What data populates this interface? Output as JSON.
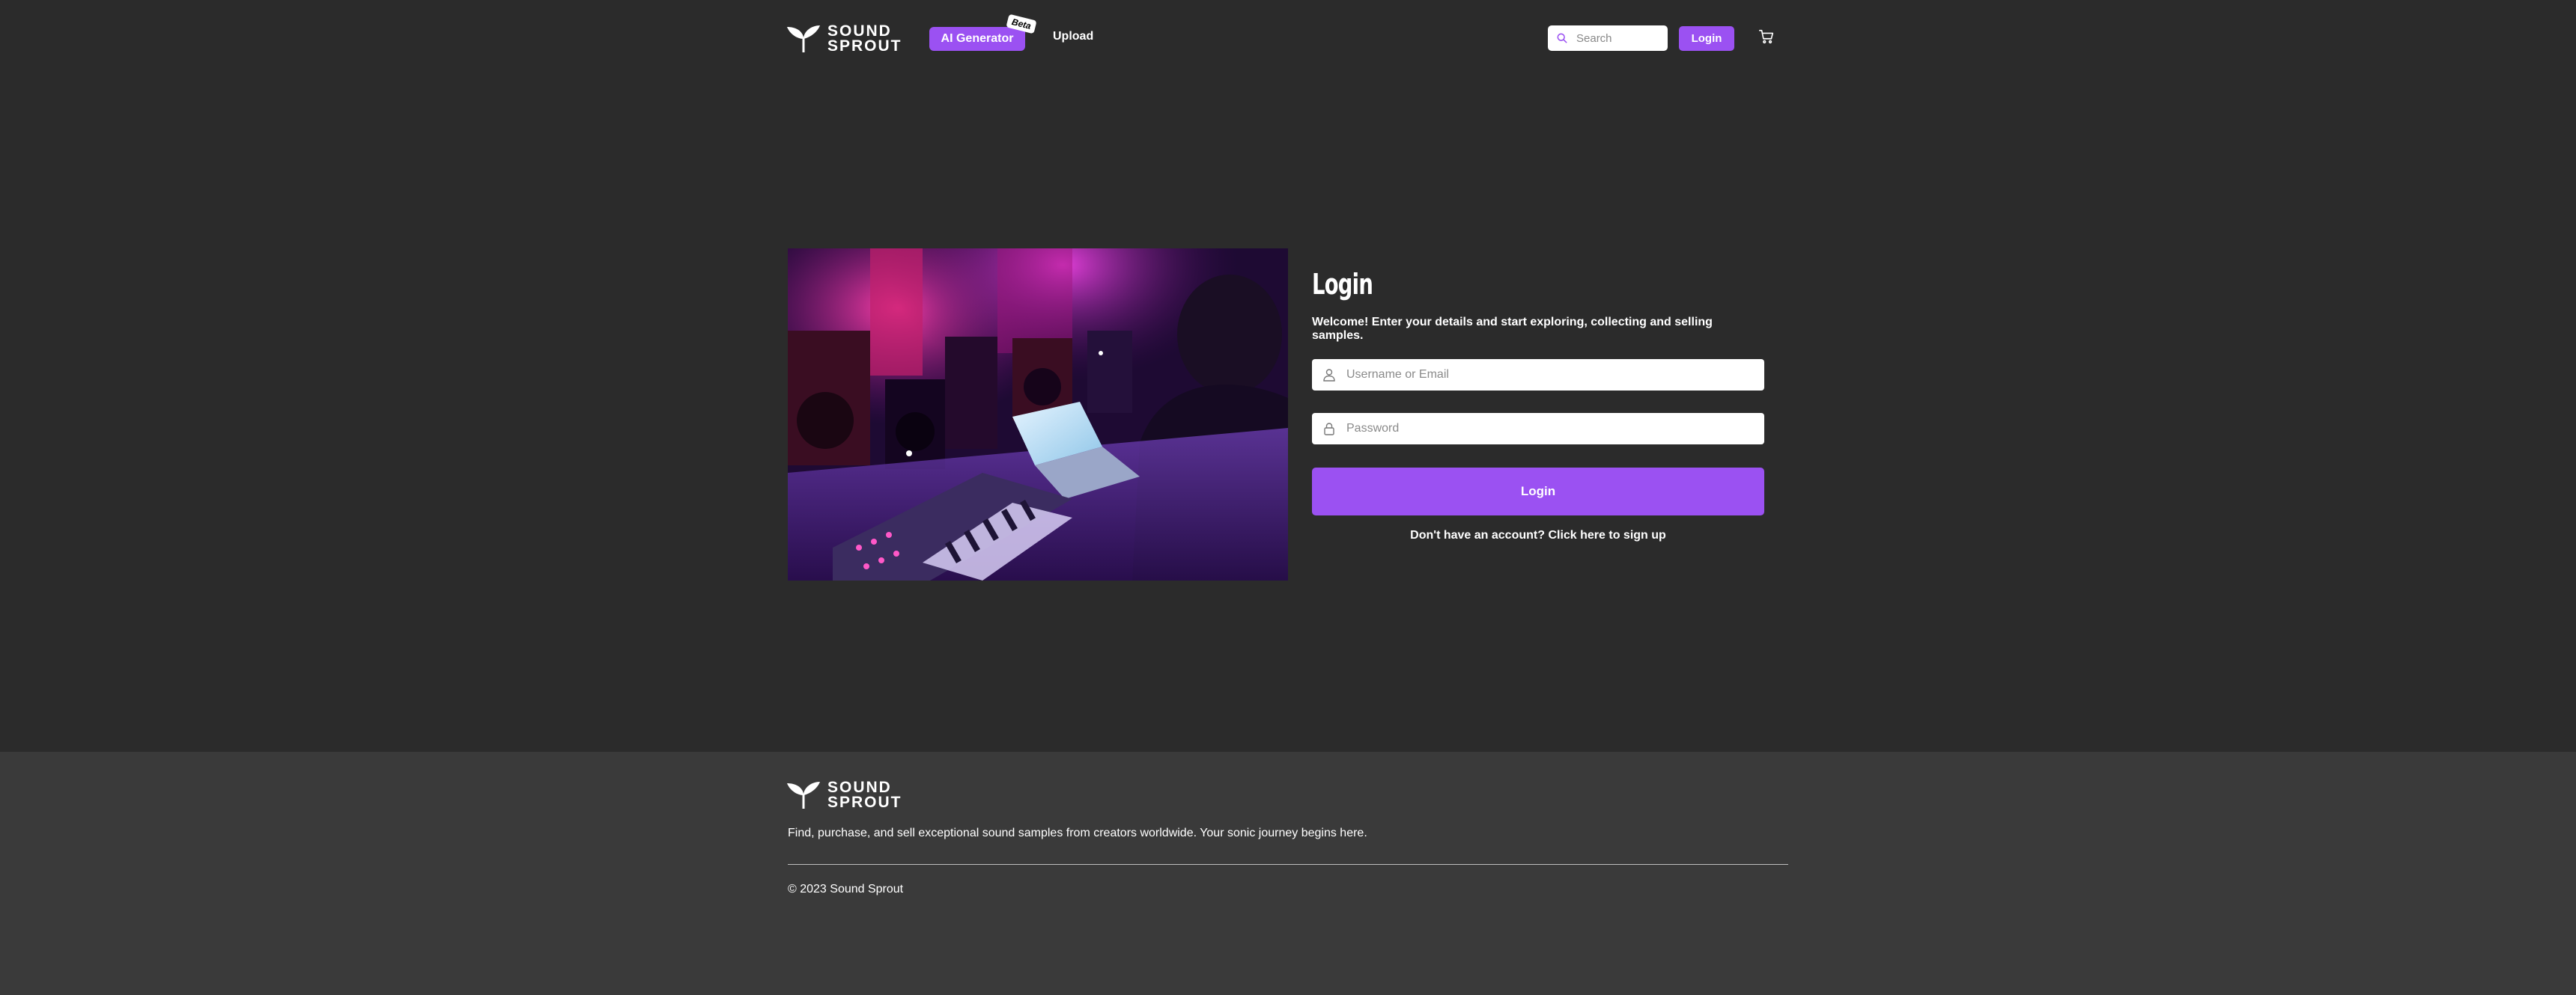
{
  "brand": {
    "logo_line1": "SOUND",
    "logo_line2": "SPROUT"
  },
  "nav": {
    "ai_generator": "AI Generator",
    "beta_badge": "Beta",
    "upload": "Upload"
  },
  "header": {
    "search_placeholder": "Search",
    "login_button": "Login",
    "cart_icon": "cart-icon"
  },
  "login": {
    "title": "Login",
    "welcome": "Welcome! Enter your details and start exploring, collecting and selling samples.",
    "username_placeholder": "Username or Email",
    "password_placeholder": "Password",
    "submit": "Login",
    "signup_link": "Don't have an account? Click here to sign up"
  },
  "footer": {
    "tagline": "Find, purchase, and sell exceptional sound samples from creators worldwide. Your sonic journey begins here.",
    "copyright": "© 2023 Sound Sprout"
  },
  "colors": {
    "background": "#2b2b2b",
    "footer_background": "#3a3a3a",
    "accent": "#9b51f2"
  }
}
